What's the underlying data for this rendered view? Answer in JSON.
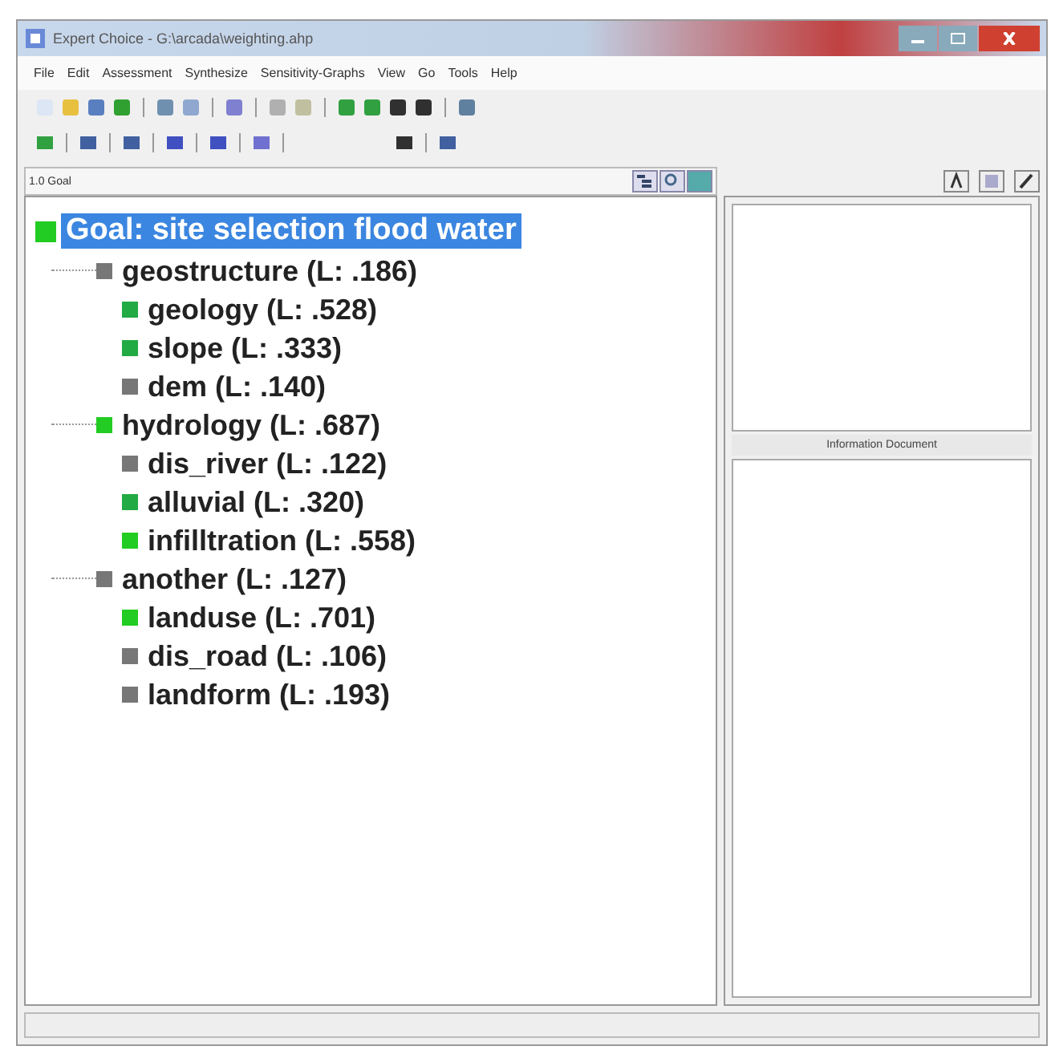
{
  "window": {
    "title": "Expert Choice - G:\\arcada\\weighting.ahp"
  },
  "menu": [
    "File",
    "Edit",
    "Assessment",
    "Synthesize",
    "Sensitivity-Graphs",
    "View",
    "Go",
    "Tools",
    "Help"
  ],
  "path": "1.0 Goal",
  "tree": {
    "label": "Goal: site selection flood water",
    "color": "#22cc22",
    "selected": true,
    "children": [
      {
        "label": "geostructure (L: .186)",
        "color": "#777777",
        "selected": false,
        "children": [
          {
            "label": "geology (L: .528)",
            "color": "#22aa44",
            "selected": false
          },
          {
            "label": "slope (L: .333)",
            "color": "#22aa44",
            "selected": false
          },
          {
            "label": "dem (L: .140)",
            "color": "#777777",
            "selected": false
          }
        ]
      },
      {
        "label": "hydrology (L: .687)",
        "color": "#22cc22",
        "selected": false,
        "children": [
          {
            "label": "dis_river (L: .122)",
            "color": "#777777",
            "selected": false
          },
          {
            "label": "alluvial (L: .320)",
            "color": "#22aa44",
            "selected": false
          },
          {
            "label": "infilltration (L: .558)",
            "color": "#22cc22",
            "selected": false
          }
        ]
      },
      {
        "label": "another (L: .127)",
        "color": "#777777",
        "selected": false,
        "children": [
          {
            "label": "landuse (L: .701)",
            "color": "#22cc22",
            "selected": false
          },
          {
            "label": "dis_road (L: .106)",
            "color": "#777777",
            "selected": false
          },
          {
            "label": "landform (L: .193)",
            "color": "#777777",
            "selected": false
          }
        ]
      }
    ]
  },
  "info_panel": {
    "label": "Information Document"
  }
}
